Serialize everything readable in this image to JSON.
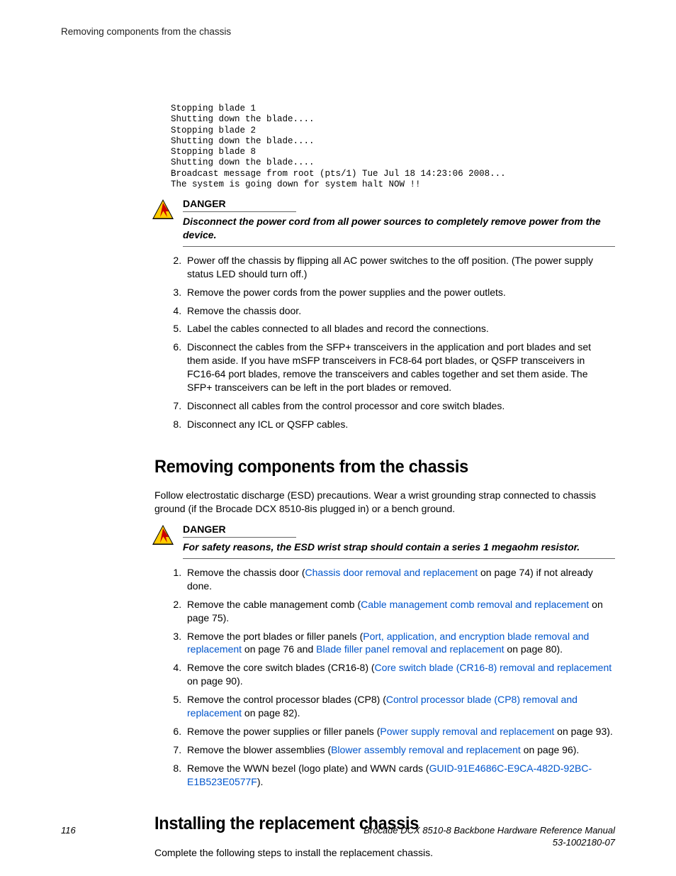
{
  "header": {
    "running_title": "Removing components from the chassis"
  },
  "code": "Stopping blade 1\nShutting down the blade....\nStopping blade 2\nShutting down the blade....\nStopping blade 8\nShutting down the blade....\nBroadcast message from root (pts/1) Tue Jul 18 14:23:06 2008...\nThe system is going down for system halt NOW !!",
  "danger1": {
    "label": "DANGER",
    "body": "Disconnect the power cord from all power sources to completely remove power from the device."
  },
  "steps_a": {
    "s2": "Power off the chassis by flipping all AC power switches to the off position. (The power supply status LED should turn off.)",
    "s3": "Remove the power cords from the power supplies and the power outlets.",
    "s4": "Remove the chassis door.",
    "s5": "Label the cables connected to all blades and record the connections.",
    "s6": "Disconnect the cables from the SFP+ transceivers in the application and port blades and set them aside. If you have mSFP transceivers in FC8-64 port blades, or QSFP transceivers in FC16-64 port blades, remove the transceivers and cables together and set them aside. The SFP+ transceivers can be left in the port blades or removed.",
    "s7": "Disconnect all cables from the control processor and core switch blades.",
    "s8": "Disconnect any ICL or QSFP cables."
  },
  "section1": {
    "title": "Removing components from the chassis",
    "intro": "Follow electrostatic discharge (ESD) precautions. Wear a wrist grounding strap connected to chassis ground (if the Brocade DCX 8510-8is plugged in) or a bench ground."
  },
  "danger2": {
    "label": "DANGER",
    "body": "For safety reasons, the ESD wrist strap should contain a series 1 megaohm resistor."
  },
  "steps_b": {
    "s1_pre": "Remove the chassis door (",
    "s1_link": "Chassis door removal and replacement",
    "s1_post": " on page 74) if not already done.",
    "s2_pre": "Remove the cable management comb (",
    "s2_link": "Cable management comb removal and replacement",
    "s2_post": " on page 75).",
    "s3_pre": "Remove the port blades or filler panels (",
    "s3_link1": "Port, application, and encryption blade removal and replacement",
    "s3_mid": " on page 76 and ",
    "s3_link2": "Blade filler panel removal and replacement",
    "s3_post": " on page 80).",
    "s4_pre": "Remove the core switch blades (CR16-8) (",
    "s4_link": "Core switch blade (CR16-8) removal and replacement",
    "s4_post": " on page 90).",
    "s5_pre": "Remove the control processor blades (CP8) (",
    "s5_link": "Control processor blade (CP8) removal and replacement",
    "s5_post": " on page 82).",
    "s6_pre": "Remove the power supplies or filler panels (",
    "s6_link": "Power supply removal and replacement",
    "s6_post": " on page 93).",
    "s7_pre": "Remove the blower assemblies (",
    "s7_link": "Blower assembly removal and replacement",
    "s7_post": " on page 96).",
    "s8_pre": "Remove the WWN bezel (logo plate) and WWN cards (",
    "s8_link": "GUID-91E4686C-E9CA-482D-92BC-E1B523E0577F",
    "s8_post": ")."
  },
  "section2": {
    "title": "Installing the replacement chassis",
    "intro": "Complete the following steps to install the replacement chassis."
  },
  "footer": {
    "page": "116",
    "title": "Brocade DCX 8510-8 Backbone Hardware Reference Manual",
    "docnum": "53-1002180-07"
  }
}
